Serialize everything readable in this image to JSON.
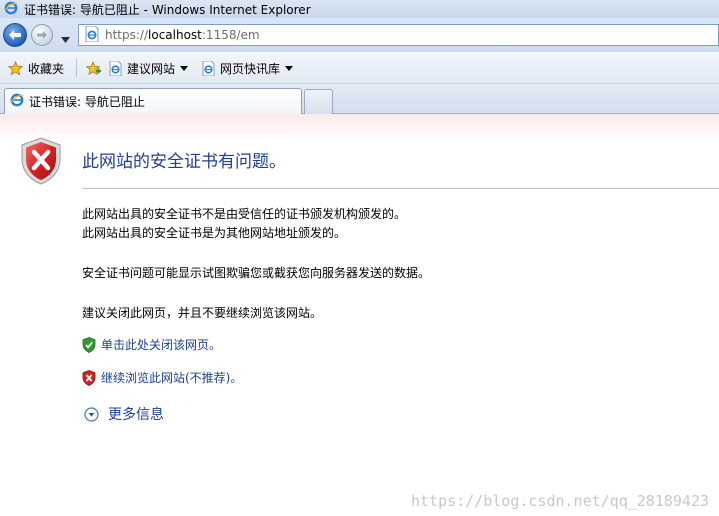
{
  "window": {
    "title": "证书错误: 导航已阻止 - Windows Internet Explorer"
  },
  "navigation": {
    "url_prefix": "https://",
    "url_host": "localhost",
    "url_rest": ":1158/em",
    "back_icon": "back-arrow-icon",
    "forward_icon": "forward-arrow-icon"
  },
  "favorites_bar": {
    "favorites_label": "收藏夹",
    "items": [
      {
        "label": "建议网站",
        "icon": "ie-page-icon"
      },
      {
        "label": "网页快讯库",
        "icon": "ie-page-icon"
      }
    ]
  },
  "tabs": [
    {
      "label": "证书错误: 导航已阻止",
      "active": true
    }
  ],
  "page": {
    "heading": "此网站的安全证书有问题。",
    "paragraph_1_line_1": "此网站出具的安全证书不是由受信任的证书颁发机构颁发的。",
    "paragraph_1_line_2": "此网站出具的安全证书是为其他网站地址颁发的。",
    "paragraph_2": "安全证书问题可能显示试图欺骗您或截获您向服务器发送的数据。",
    "paragraph_3": "建议关闭此网页，并且不要继续浏览该网站。",
    "link_close": "单击此处关闭该网页。",
    "link_continue": "继续浏览此网站(不推荐)。",
    "more_info": "更多信息"
  },
  "watermark": "https://blog.csdn.net/qq_28189423",
  "colors": {
    "heading": "#1f3f8f",
    "link": "#1f3f8f",
    "shield_red": "#d42020",
    "shield_green": "#2f9a2f"
  }
}
